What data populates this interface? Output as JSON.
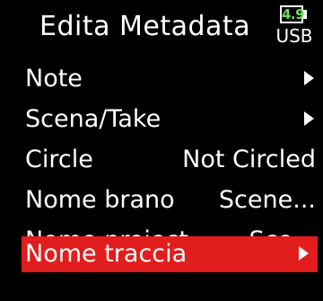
{
  "header": {
    "title": "Edita Metadata",
    "battery": {
      "level": "4.9",
      "source": "USB",
      "level_color": "#6fdc5c"
    }
  },
  "menu": {
    "items": [
      {
        "label": "Note",
        "value": "",
        "arrow": true
      },
      {
        "label": "Scena/Take",
        "value": "",
        "arrow": true
      },
      {
        "label": "Circle",
        "value": "Not Circled",
        "arrow": false
      },
      {
        "label": "Nome brano",
        "value": "Scene...",
        "arrow": false
      },
      {
        "label": "Nome project",
        "value": "Sce...",
        "arrow": false
      },
      {
        "label": "Nome traccia",
        "value": "",
        "arrow": true,
        "selected": true
      }
    ]
  },
  "colors": {
    "background": "#000000",
    "text": "#ffffff",
    "selection": "#e21d1d"
  }
}
